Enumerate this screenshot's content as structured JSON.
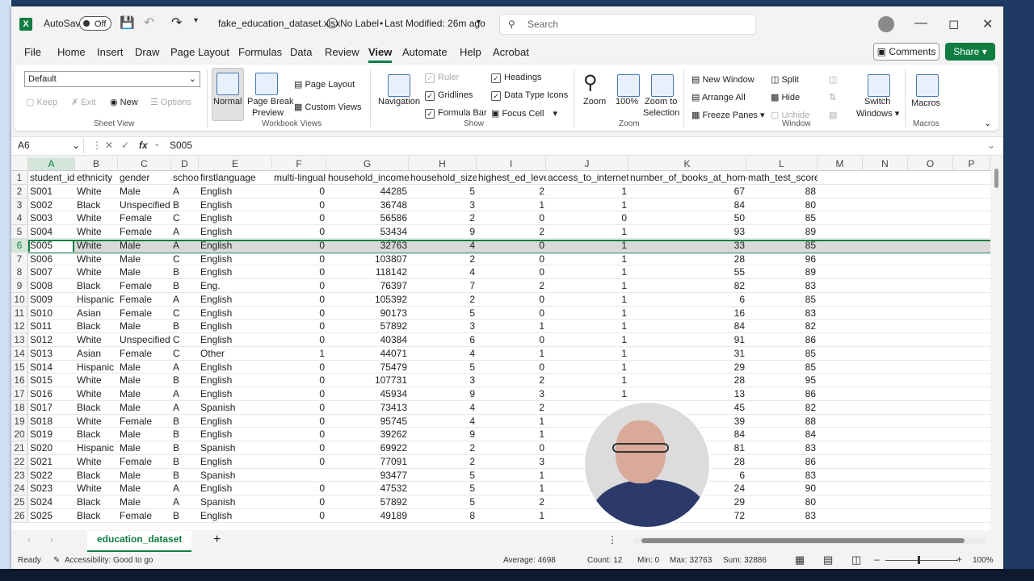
{
  "titlebar": {
    "autosave_label": "AutoSave",
    "autosave_state": "Off",
    "filename": "fake_education_dataset.xlsx",
    "label_status": "No Label",
    "modified": "Last Modified: 26m ago",
    "search_placeholder": "Search",
    "icons": [
      "excel-logo",
      "save-icon",
      "undo-icon",
      "redo-icon",
      "customize-icon",
      "sensitivity-icon",
      "search-icon",
      "minimize-icon",
      "maximize-icon",
      "close-icon"
    ]
  },
  "menu": {
    "items": [
      "File",
      "Home",
      "Insert",
      "Draw",
      "Page Layout",
      "Formulas",
      "Data",
      "Review",
      "View",
      "Automate",
      "Help",
      "Acrobat"
    ],
    "active": "View",
    "comments_label": "Comments",
    "share_label": "Share"
  },
  "ribbon": {
    "sheet_view": {
      "dropdown_value": "Default",
      "keep": "Keep",
      "exit": "Exit",
      "new": "New",
      "options": "Options",
      "label": "Sheet View"
    },
    "workbook_views": {
      "normal": "Normal",
      "page_break_preview_1": "Page Break",
      "page_break_preview_2": "Preview",
      "page_layout": "Page Layout",
      "custom_views": "Custom Views",
      "label": "Workbook Views"
    },
    "show": {
      "navigation": "Navigation",
      "ruler": "Ruler",
      "gridlines": "Gridlines",
      "formula_bar": "Formula Bar",
      "headings": "Headings",
      "data_type_icons": "Data Type Icons",
      "focus_cell": "Focus Cell",
      "label": "Show"
    },
    "zoom": {
      "zoom": "Zoom",
      "hundred": "100%",
      "zoom_to_selection_1": "Zoom to",
      "zoom_to_selection_2": "Selection",
      "label": "Zoom"
    },
    "window": {
      "new_window": "New Window",
      "arrange_all": "Arrange All",
      "freeze_panes": "Freeze Panes",
      "split": "Split",
      "hide": "Hide",
      "unhide": "Unhide",
      "switch_windows_1": "Switch",
      "switch_windows_2": "Windows",
      "label": "Window"
    },
    "macros": {
      "macros": "Macros",
      "label": "Macros"
    }
  },
  "formula_bar": {
    "name_box": "A6",
    "fx": "fx",
    "value": "S005"
  },
  "sheet": {
    "columns": [
      "A",
      "B",
      "C",
      "D",
      "E",
      "F",
      "G",
      "H",
      "I",
      "J",
      "K",
      "L",
      "M",
      "N",
      "O",
      "P"
    ],
    "row_numbers": [
      "1",
      "2",
      "3",
      "4",
      "5",
      "6",
      "7",
      "8",
      "9",
      "10",
      "11",
      "12",
      "13",
      "14",
      "15",
      "16",
      "17",
      "18",
      "19",
      "20",
      "21",
      "22",
      "23",
      "24",
      "25",
      "26"
    ],
    "header": [
      "student_id",
      "ethnicity",
      "gender",
      "school",
      "firstlanguage",
      "multi-lingual",
      "household_income",
      "household_size",
      "highest_ed_level",
      "access_to_internet",
      "number_of_books_at_home",
      "math_test_score"
    ],
    "rows": [
      [
        "S001",
        "White",
        "Male",
        "A",
        "English",
        "0",
        "44285",
        "5",
        "2",
        "1",
        "67",
        "88"
      ],
      [
        "S002",
        "Black",
        "Unspecified",
        "B",
        "English",
        "0",
        "36748",
        "3",
        "1",
        "1",
        "84",
        "80"
      ],
      [
        "S003",
        "White",
        "Female",
        "C",
        "English",
        "0",
        "56586",
        "2",
        "0",
        "0",
        "50",
        "85"
      ],
      [
        "S004",
        "White",
        "Female",
        "A",
        "English",
        "0",
        "53434",
        "9",
        "2",
        "1",
        "93",
        "89"
      ],
      [
        "S005",
        "White",
        "Male",
        "A",
        "English",
        "0",
        "32763",
        "4",
        "0",
        "1",
        "33",
        "85"
      ],
      [
        "S006",
        "White",
        "Male",
        "C",
        "English",
        "0",
        "103807",
        "2",
        "0",
        "1",
        "28",
        "96"
      ],
      [
        "S007",
        "White",
        "Male",
        "B",
        "English",
        "0",
        "118142",
        "4",
        "0",
        "1",
        "55",
        "89"
      ],
      [
        "S008",
        "Black",
        "Female",
        "B",
        "Eng.",
        "0",
        "76397",
        "7",
        "2",
        "1",
        "82",
        "83"
      ],
      [
        "S009",
        "Hispanic",
        "Female",
        "A",
        "English",
        "0",
        "105392",
        "2",
        "0",
        "1",
        "6",
        "85"
      ],
      [
        "S010",
        "Asian",
        "Female",
        "C",
        "English",
        "0",
        "90173",
        "5",
        "0",
        "1",
        "16",
        "83"
      ],
      [
        "S011",
        "Black",
        "Male",
        "B",
        "English",
        "0",
        "57892",
        "3",
        "1",
        "1",
        "84",
        "82"
      ],
      [
        "S012",
        "White",
        "Unspecified",
        "C",
        "English",
        "0",
        "40384",
        "6",
        "0",
        "1",
        "91",
        "86"
      ],
      [
        "S013",
        "Asian",
        "Female",
        "C",
        "Other",
        "1",
        "44071",
        "4",
        "1",
        "1",
        "31",
        "85"
      ],
      [
        "S014",
        "Hispanic",
        "Male",
        "A",
        "English",
        "0",
        "75479",
        "5",
        "0",
        "1",
        "29",
        "85"
      ],
      [
        "S015",
        "White",
        "Male",
        "B",
        "English",
        "0",
        "107731",
        "3",
        "2",
        "1",
        "28",
        "95"
      ],
      [
        "S016",
        "White",
        "Male",
        "A",
        "English",
        "0",
        "45934",
        "9",
        "3",
        "1",
        "13",
        "86"
      ],
      [
        "S017",
        "Black",
        "Male",
        "A",
        "Spanish",
        "0",
        "73413",
        "4",
        "2",
        "",
        "45",
        "82"
      ],
      [
        "S018",
        "White",
        "Female",
        "B",
        "English",
        "0",
        "95745",
        "4",
        "1",
        "",
        "39",
        "88"
      ],
      [
        "S019",
        "Black",
        "Male",
        "B",
        "English",
        "0",
        "39262",
        "9",
        "1",
        "",
        "84",
        "84"
      ],
      [
        "S020",
        "Hispanic",
        "Male",
        "B",
        "Spanish",
        "0",
        "69922",
        "2",
        "0",
        "",
        "81",
        "83"
      ],
      [
        "S021",
        "White",
        "Female",
        "B",
        "English",
        "0",
        "77091",
        "2",
        "3",
        "",
        "28",
        "86"
      ],
      [
        "S022",
        "Black",
        "Male",
        "B",
        "Spanish",
        "",
        "93477",
        "5",
        "1",
        "",
        "6",
        "83"
      ],
      [
        "S023",
        "White",
        "Male",
        "A",
        "English",
        "0",
        "47532",
        "5",
        "1",
        "",
        "24",
        "90"
      ],
      [
        "S024",
        "Black",
        "Male",
        "A",
        "Spanish",
        "0",
        "57892",
        "5",
        "2",
        "",
        "29",
        "80"
      ],
      [
        "S025",
        "Black",
        "Female",
        "B",
        "English",
        "0",
        "49189",
        "8",
        "1",
        "",
        "72",
        "83"
      ]
    ],
    "sheet_tab": "education_dataset"
  },
  "status": {
    "ready": "Ready",
    "accessibility": "Accessibility: Good to go",
    "average": "Average: 4698",
    "count": "Count: 12",
    "min": "Min: 0",
    "max": "Max: 32763",
    "sum": "Sum: 32886",
    "zoom": "100%"
  },
  "colors": {
    "excel_green": "#107c41",
    "selection_row": "#d9d9d9"
  }
}
